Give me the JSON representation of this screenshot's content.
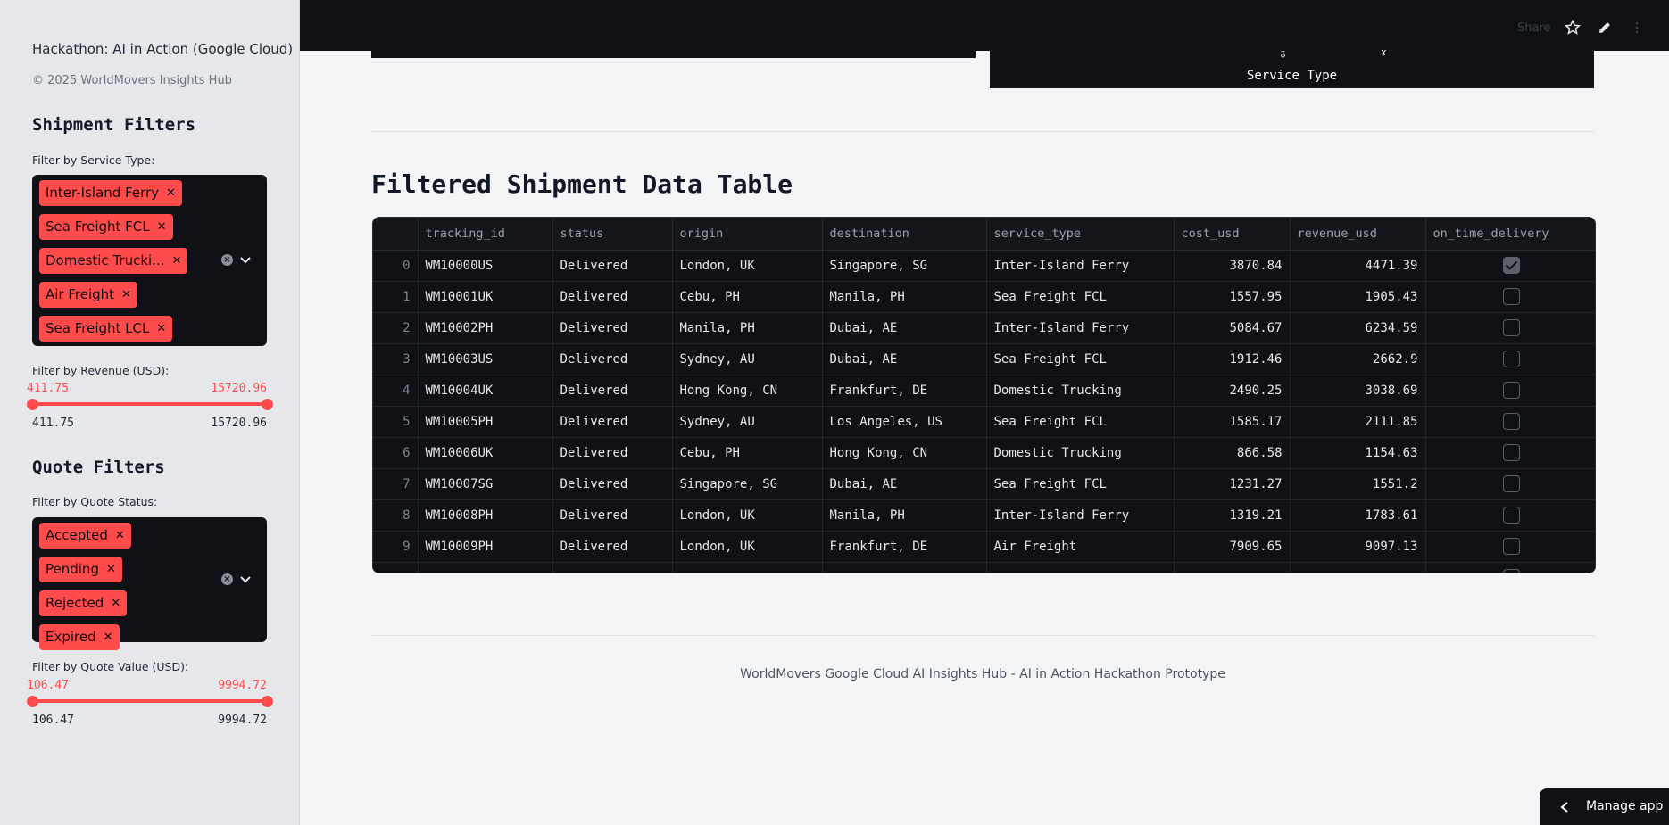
{
  "sidebar": {
    "title": "Hackathon: AI in Action (Google Cloud)",
    "copyright": "© 2025 WorldMovers Insights Hub",
    "shipment_filters": {
      "heading": "Shipment Filters",
      "service_label": "Filter by Service Type:",
      "service_chips": [
        "Inter-Island Ferry",
        "Sea Freight FCL",
        "Domestic Trucki...",
        "Air Freight",
        "Sea Freight LCL"
      ],
      "revenue_label": "Filter by Revenue (USD):",
      "revenue_min": "411.75",
      "revenue_max": "15720.96",
      "revenue_range_min": "411.75",
      "revenue_range_max": "15720.96"
    },
    "quote_filters": {
      "heading": "Quote Filters",
      "status_label": "Filter by Quote Status:",
      "status_chips": [
        "Accepted",
        "Pending",
        "Rejected",
        "Expired"
      ],
      "value_label": "Filter by Quote Value (USD):",
      "value_min": "106.47",
      "value_max": "9994.72",
      "value_range_min": "106.47",
      "value_range_max": "9994.72"
    }
  },
  "topbar": {
    "share_label": "Share"
  },
  "chart": {
    "axis_label": "Service Type"
  },
  "main": {
    "table_title": "Filtered Shipment Data Table",
    "footer": "WorldMovers Google Cloud AI Insights Hub - AI in Action Hackathon Prototype"
  },
  "table": {
    "columns": [
      "",
      "tracking_id",
      "status",
      "origin",
      "destination",
      "service_type",
      "cost_usd",
      "revenue_usd",
      "on_time_delivery"
    ],
    "rows": [
      [
        "0",
        "WM10000US",
        "Delivered",
        "London, UK",
        "Singapore, SG",
        "Inter-Island Ferry",
        "3870.84",
        "4471.39",
        true
      ],
      [
        "1",
        "WM10001UK",
        "Delivered",
        "Cebu, PH",
        "Manila, PH",
        "Sea Freight FCL",
        "1557.95",
        "1905.43",
        false
      ],
      [
        "2",
        "WM10002PH",
        "Delivered",
        "Manila, PH",
        "Dubai, AE",
        "Inter-Island Ferry",
        "5084.67",
        "6234.59",
        false
      ],
      [
        "3",
        "WM10003US",
        "Delivered",
        "Sydney, AU",
        "Dubai, AE",
        "Sea Freight FCL",
        "1912.46",
        "2662.9",
        false
      ],
      [
        "4",
        "WM10004UK",
        "Delivered",
        "Hong Kong, CN",
        "Frankfurt, DE",
        "Domestic Trucking",
        "2490.25",
        "3038.69",
        false
      ],
      [
        "5",
        "WM10005PH",
        "Delivered",
        "Sydney, AU",
        "Los Angeles, US",
        "Sea Freight FCL",
        "1585.17",
        "2111.85",
        false
      ],
      [
        "6",
        "WM10006UK",
        "Delivered",
        "Cebu, PH",
        "Hong Kong, CN",
        "Domestic Trucking",
        "866.58",
        "1154.63",
        false
      ],
      [
        "7",
        "WM10007SG",
        "Delivered",
        "Singapore, SG",
        "Dubai, AE",
        "Sea Freight FCL",
        "1231.27",
        "1551.2",
        false
      ],
      [
        "8",
        "WM10008PH",
        "Delivered",
        "London, UK",
        "Manila, PH",
        "Inter-Island Ferry",
        "1319.21",
        "1783.61",
        false
      ],
      [
        "9",
        "WM10009PH",
        "Delivered",
        "London, UK",
        "Frankfurt, DE",
        "Air Freight",
        "7909.65",
        "9097.13",
        false
      ]
    ]
  },
  "manage_app": {
    "label": "Manage app"
  },
  "colors": {
    "accent": "#ff4b4b",
    "dark_panel": "#0f1116",
    "sidebar_bg": "#e5e7eb"
  }
}
